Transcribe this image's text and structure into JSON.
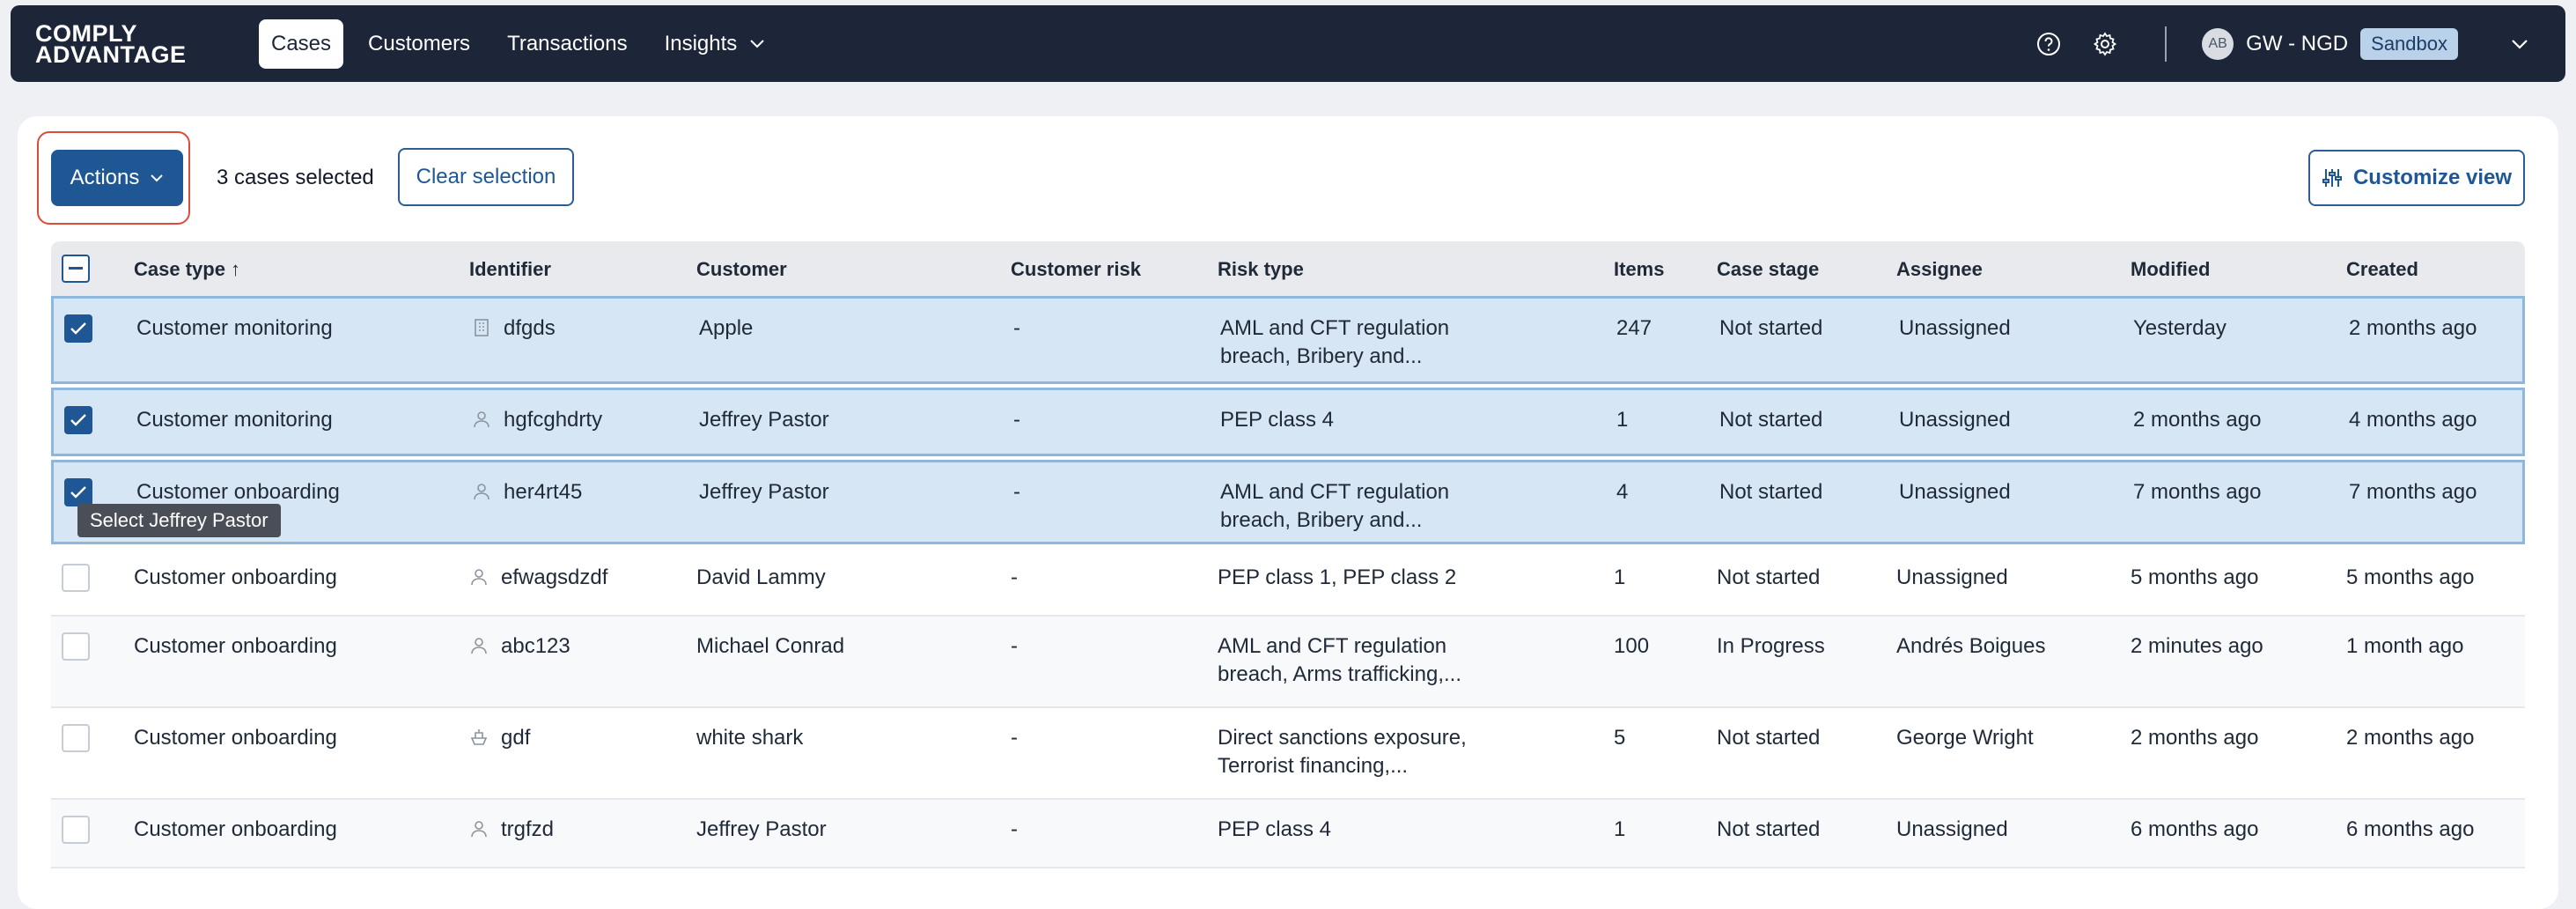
{
  "nav": {
    "logo_line1": "COMPLY",
    "logo_line2": "ADVANTAGE",
    "links": [
      {
        "label": "Cases",
        "active": true
      },
      {
        "label": "Customers"
      },
      {
        "label": "Transactions"
      },
      {
        "label": "Insights",
        "dropdown": true
      }
    ],
    "avatar_initials": "AB",
    "org_name": "GW - NGD",
    "env_badge": "Sandbox",
    "icons": [
      "help-icon",
      "gear-icon",
      "chevron-down-icon"
    ]
  },
  "toolbar": {
    "actions_label": "Actions",
    "selected_text": "3 cases selected",
    "clear_label": "Clear selection",
    "customize_label": "Customize view"
  },
  "table": {
    "columns": [
      "Case type ↑",
      "Identifier",
      "Customer",
      "Customer risk",
      "Risk type",
      "Items",
      "Case stage",
      "Assignee",
      "Modified",
      "Created"
    ],
    "rows": [
      {
        "selected": true,
        "case_type": "Customer monitoring",
        "id_icon": "building-icon",
        "identifier": "dfgds",
        "customer": "Apple",
        "risk": "-",
        "risk_type": "AML and CFT regulation breach, Bribery and...",
        "items": "247",
        "stage": "Not started",
        "assignee": "Unassigned",
        "modified": "Yesterday",
        "created": "2 months ago"
      },
      {
        "selected": true,
        "case_type": "Customer monitoring",
        "id_icon": "person-icon",
        "identifier": "hgfcghdrty",
        "customer": "Jeffrey Pastor",
        "risk": "-",
        "risk_type": "PEP class 4",
        "items": "1",
        "stage": "Not started",
        "assignee": "Unassigned",
        "modified": "2 months ago",
        "created": "4 months ago"
      },
      {
        "selected": true,
        "case_type": "Customer onboarding",
        "id_icon": "person-icon",
        "identifier": "her4rt45",
        "customer": "Jeffrey Pastor",
        "risk": "-",
        "risk_type": "AML and CFT regulation breach, Bribery and...",
        "items": "4",
        "stage": "Not started",
        "assignee": "Unassigned",
        "modified": "7 months ago",
        "created": "7 months ago"
      },
      {
        "selected": false,
        "case_type": "Customer onboarding",
        "id_icon": "person-icon",
        "identifier": "efwagsdzdf",
        "customer": "David Lammy",
        "risk": "-",
        "risk_type": "PEP class 1, PEP class 2",
        "items": "1",
        "stage": "Not started",
        "assignee": "Unassigned",
        "modified": "5 months ago",
        "created": "5 months ago"
      },
      {
        "selected": false,
        "case_type": "Customer onboarding",
        "id_icon": "person-icon",
        "identifier": "abc123",
        "customer": "Michael Conrad",
        "risk": "-",
        "risk_type": "AML and CFT regulation breach, Arms trafficking,...",
        "items": "100",
        "stage": "In Progress",
        "assignee": "Andrés Boigues",
        "modified": "2 minutes ago",
        "created": "1 month ago"
      },
      {
        "selected": false,
        "case_type": "Customer onboarding",
        "id_icon": "vessel-icon",
        "identifier": "gdf",
        "customer": "white shark",
        "risk": "-",
        "risk_type": "Direct sanctions exposure, Terrorist financing,...",
        "items": "5",
        "stage": "Not started",
        "assignee": "George Wright",
        "modified": "2 months ago",
        "created": "2 months ago"
      },
      {
        "selected": false,
        "case_type": "Customer onboarding",
        "id_icon": "person-icon",
        "identifier": "trgfzd",
        "customer": "Jeffrey Pastor",
        "risk": "-",
        "risk_type": "PEP class 4",
        "items": "1",
        "stage": "Not started",
        "assignee": "Unassigned",
        "modified": "6 months ago",
        "created": "6 months ago"
      }
    ]
  },
  "tooltip": "Select Jeffrey Pastor",
  "colors": {
    "nav_bg": "#1c2638",
    "primary": "#1f5795",
    "selected_row": "#d7e6f4",
    "highlight": "#e04a3a"
  }
}
